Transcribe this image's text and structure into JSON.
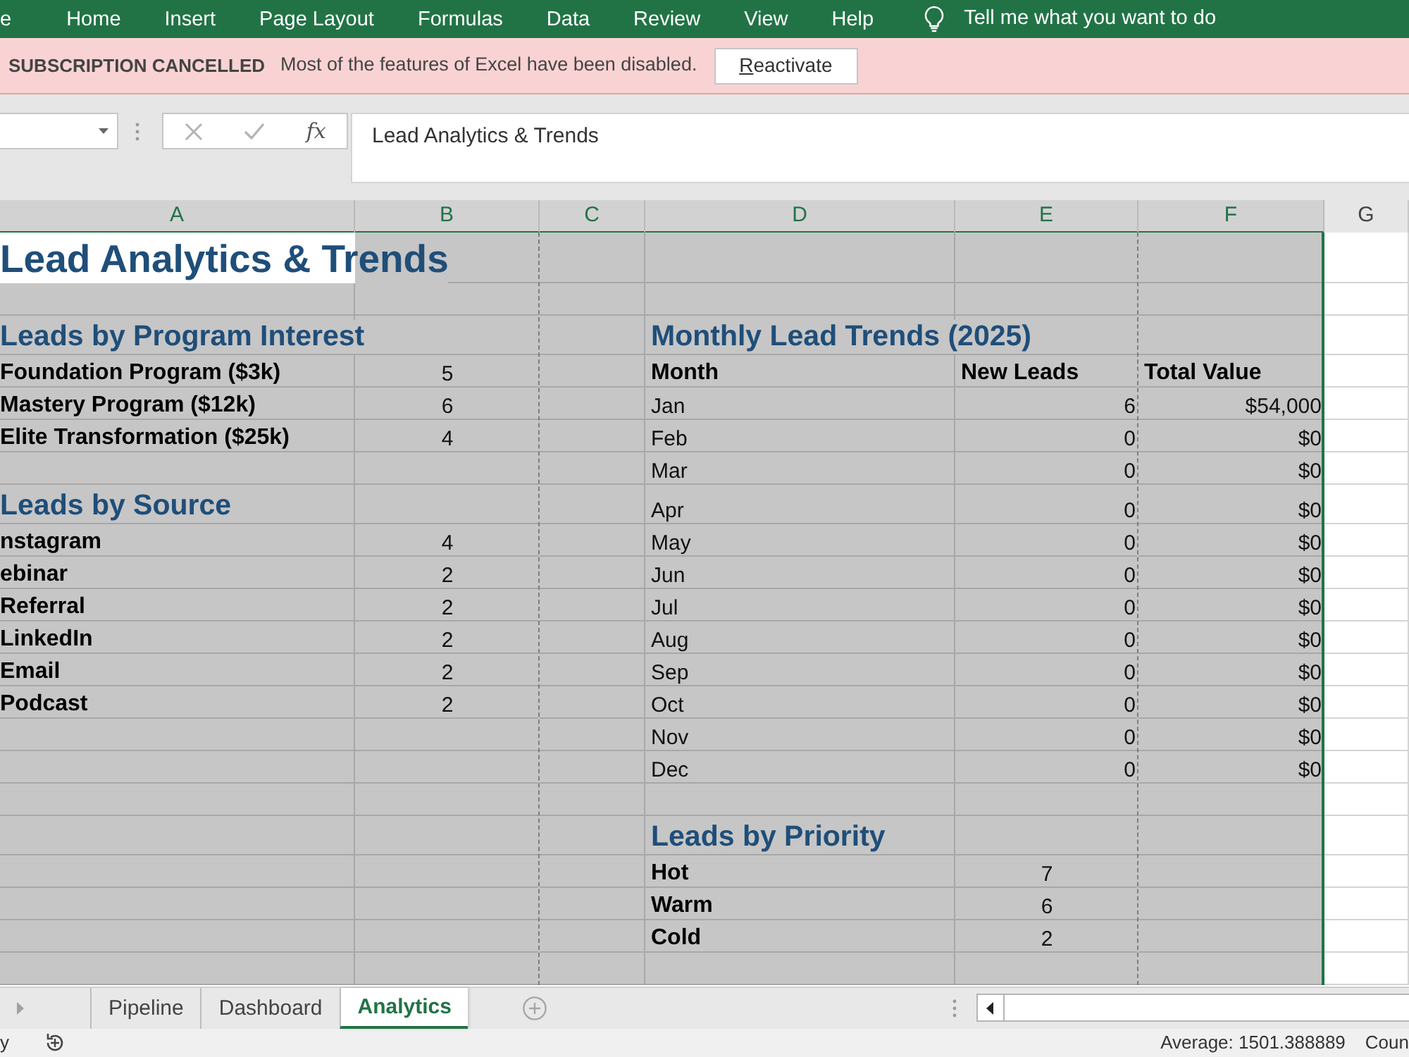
{
  "ribbon": {
    "tabs": [
      {
        "label": "e"
      },
      {
        "label": "Home"
      },
      {
        "label": "Insert"
      },
      {
        "label": "Page Layout"
      },
      {
        "label": "Formulas"
      },
      {
        "label": "Data"
      },
      {
        "label": "Review"
      },
      {
        "label": "View"
      },
      {
        "label": "Help"
      }
    ],
    "tell_me": "Tell me what you want to do"
  },
  "banner": {
    "title": "SUBSCRIPTION CANCELLED",
    "message": "Most of the features of Excel have been disabled.",
    "button": {
      "label": "Reactivate",
      "mnemonic": true
    }
  },
  "formula_bar": {
    "function_label": "fx",
    "value": "Lead Analytics & Trends"
  },
  "columns": [
    {
      "label": "A",
      "selected": true,
      "page_break": false
    },
    {
      "label": "B",
      "selected": true,
      "page_break": true
    },
    {
      "label": "C",
      "selected": true,
      "page_break": false
    },
    {
      "label": "D",
      "selected": true,
      "page_break": false
    },
    {
      "label": "E",
      "selected": true,
      "page_break": true
    },
    {
      "label": "F",
      "selected": true,
      "page_break": false
    },
    {
      "label": "G",
      "selected": false,
      "page_break": false
    }
  ],
  "rows": [
    {
      "a": {
        "kind": "title",
        "text": "Lead Analytics & Trends",
        "active": true
      }
    },
    {},
    {
      "a": {
        "kind": "heading",
        "text": "Leads by Program Interest",
        "active": false
      },
      "d": {
        "kind": "heading",
        "text": "Monthly Lead Trends (2025)",
        "active": false
      }
    },
    {
      "a": {
        "kind": "label",
        "text": "Foundation Program ($3k)",
        "active": false
      },
      "b": {
        "kind": "count",
        "text": "5",
        "active": false
      },
      "d": {
        "kind": "label",
        "text": "Month",
        "active": false
      },
      "e": {
        "kind": "label",
        "text": "New Leads",
        "active": false
      },
      "f": {
        "kind": "label",
        "text": "Total Value",
        "active": false
      }
    },
    {
      "a": {
        "kind": "label",
        "text": "Mastery Program ($12k)",
        "active": false
      },
      "b": {
        "kind": "count",
        "text": "6",
        "active": false
      },
      "d": {
        "kind": "text",
        "text": "Jan",
        "active": false
      },
      "e": {
        "kind": "number",
        "text": "6",
        "active": false
      },
      "f": {
        "kind": "number",
        "text": "$54,000",
        "active": false
      }
    },
    {
      "a": {
        "kind": "label",
        "text": "Elite Transformation ($25k)",
        "active": false
      },
      "b": {
        "kind": "count",
        "text": "4",
        "active": false
      },
      "d": {
        "kind": "text",
        "text": "Feb",
        "active": false
      },
      "e": {
        "kind": "number",
        "text": "0",
        "active": false
      },
      "f": {
        "kind": "number",
        "text": "$0",
        "active": false
      }
    },
    {
      "d": {
        "kind": "text",
        "text": "Mar",
        "active": false
      },
      "e": {
        "kind": "number",
        "text": "0",
        "active": false
      },
      "f": {
        "kind": "number",
        "text": "$0",
        "active": false
      }
    },
    {
      "a": {
        "kind": "heading",
        "text": "Leads by Source",
        "active": false
      },
      "d": {
        "kind": "text",
        "text": "Apr",
        "active": false
      },
      "e": {
        "kind": "number",
        "text": "0",
        "active": false
      },
      "f": {
        "kind": "number",
        "text": "$0",
        "active": false
      }
    },
    {
      "a": {
        "kind": "label",
        "text": "nstagram",
        "active": false
      },
      "b": {
        "kind": "count",
        "text": "4",
        "active": false
      },
      "d": {
        "kind": "text",
        "text": "May",
        "active": false
      },
      "e": {
        "kind": "number",
        "text": "0",
        "active": false
      },
      "f": {
        "kind": "number",
        "text": "$0",
        "active": false
      }
    },
    {
      "a": {
        "kind": "label",
        "text": "ebinar",
        "active": false
      },
      "b": {
        "kind": "count",
        "text": "2",
        "active": false
      },
      "d": {
        "kind": "text",
        "text": "Jun",
        "active": false
      },
      "e": {
        "kind": "number",
        "text": "0",
        "active": false
      },
      "f": {
        "kind": "number",
        "text": "$0",
        "active": false
      }
    },
    {
      "a": {
        "kind": "label",
        "text": "Referral",
        "active": false
      },
      "b": {
        "kind": "count",
        "text": "2",
        "active": false
      },
      "d": {
        "kind": "text",
        "text": "Jul",
        "active": false
      },
      "e": {
        "kind": "number",
        "text": "0",
        "active": false
      },
      "f": {
        "kind": "number",
        "text": "$0",
        "active": false
      }
    },
    {
      "a": {
        "kind": "label",
        "text": "LinkedIn",
        "active": false
      },
      "b": {
        "kind": "count",
        "text": "2",
        "active": false
      },
      "d": {
        "kind": "text",
        "text": "Aug",
        "active": false
      },
      "e": {
        "kind": "number",
        "text": "0",
        "active": false
      },
      "f": {
        "kind": "number",
        "text": "$0",
        "active": false
      }
    },
    {
      "a": {
        "kind": "label",
        "text": "Email",
        "active": false
      },
      "b": {
        "kind": "count",
        "text": "2",
        "active": false
      },
      "d": {
        "kind": "text",
        "text": "Sep",
        "active": false
      },
      "e": {
        "kind": "number",
        "text": "0",
        "active": false
      },
      "f": {
        "kind": "number",
        "text": "$0",
        "active": false
      }
    },
    {
      "a": {
        "kind": "label",
        "text": "Podcast",
        "active": false
      },
      "b": {
        "kind": "count",
        "text": "2",
        "active": false
      },
      "d": {
        "kind": "text",
        "text": "Oct",
        "active": false
      },
      "e": {
        "kind": "number",
        "text": "0",
        "active": false
      },
      "f": {
        "kind": "number",
        "text": "$0",
        "active": false
      }
    },
    {
      "d": {
        "kind": "text",
        "text": "Nov",
        "active": false
      },
      "e": {
        "kind": "number",
        "text": "0",
        "active": false
      },
      "f": {
        "kind": "number",
        "text": "$0",
        "active": false
      }
    },
    {
      "d": {
        "kind": "text",
        "text": "Dec",
        "active": false
      },
      "e": {
        "kind": "number",
        "text": "0",
        "active": false
      },
      "f": {
        "kind": "number",
        "text": "$0",
        "active": false
      }
    },
    {},
    {
      "d": {
        "kind": "heading",
        "text": "Leads by Priority",
        "active": false
      }
    },
    {
      "d": {
        "kind": "label",
        "text": "Hot",
        "active": false
      },
      "e": {
        "kind": "count",
        "text": "7",
        "active": false
      }
    },
    {
      "d": {
        "kind": "label",
        "text": "Warm",
        "active": false
      },
      "e": {
        "kind": "count",
        "text": "6",
        "active": false
      }
    },
    {
      "d": {
        "kind": "label",
        "text": "Cold",
        "active": false
      },
      "e": {
        "kind": "count",
        "text": "2",
        "active": false
      }
    },
    {}
  ],
  "sheet_tabs": [
    {
      "label": "Pipeline",
      "selected": false
    },
    {
      "label": "Dashboard",
      "selected": false
    },
    {
      "label": "Analytics",
      "selected": true
    }
  ],
  "status_bar": {
    "left": "y",
    "average": "Average: 1501.388889",
    "count": "Coun"
  }
}
